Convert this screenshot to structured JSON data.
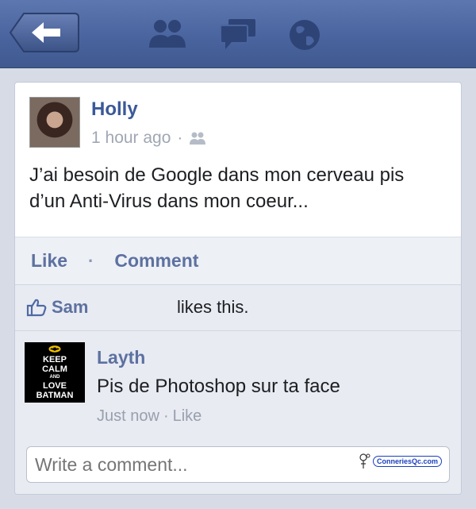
{
  "post": {
    "author": "Holly",
    "time": "1 hour ago",
    "separator": "·",
    "text_line1": "J’ai besoin de Google dans mon cerveau pis",
    "text_line2": "d’un Anti-Virus dans mon coeur..."
  },
  "actions": {
    "like_label": "Like",
    "separator": "·",
    "comment_label": "Comment"
  },
  "likes": {
    "name": "Sam",
    "suffix": "likes this."
  },
  "comment": {
    "author": "Layth",
    "text": "Pis de Photoshop sur ta face",
    "time": "Just now",
    "separator": "·",
    "like_label": "Like",
    "avatar_lines": [
      "KEEP",
      "CALM",
      "AND",
      "LOVE",
      "BATMAN"
    ]
  },
  "composer": {
    "placeholder": "Write a comment..."
  },
  "watermark": {
    "text": "ConneriesQc.com"
  },
  "icons": {
    "back": "left-arrow-icon",
    "friends": "friend-requests-icon",
    "messages": "messages-icon",
    "notifications": "globe-icon",
    "audience": "friends-audience-icon",
    "like": "thumbs-up-icon"
  },
  "colors": {
    "navbar": "#4a649f",
    "link": "#3b5998",
    "muted": "#a0a7b4"
  }
}
